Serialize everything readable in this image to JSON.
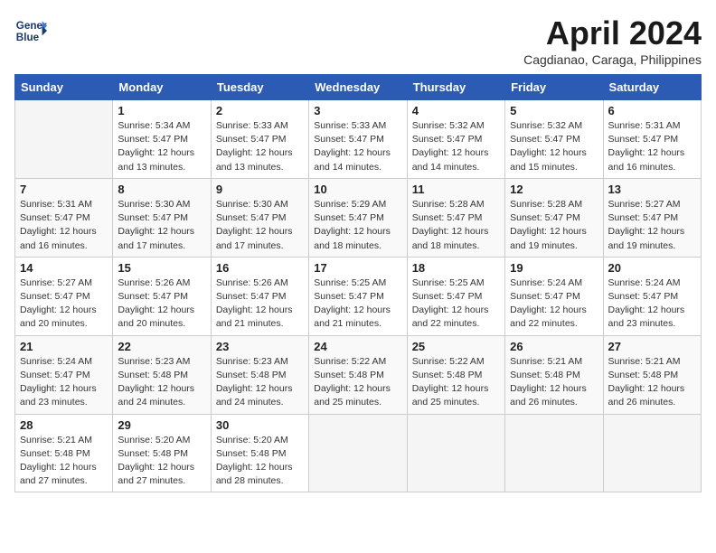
{
  "header": {
    "logo_line1": "General",
    "logo_line2": "Blue",
    "month_title": "April 2024",
    "subtitle": "Cagdianao, Caraga, Philippines"
  },
  "days_of_week": [
    "Sunday",
    "Monday",
    "Tuesday",
    "Wednesday",
    "Thursday",
    "Friday",
    "Saturday"
  ],
  "weeks": [
    [
      {
        "day": "",
        "info": ""
      },
      {
        "day": "1",
        "info": "Sunrise: 5:34 AM\nSunset: 5:47 PM\nDaylight: 12 hours\nand 13 minutes."
      },
      {
        "day": "2",
        "info": "Sunrise: 5:33 AM\nSunset: 5:47 PM\nDaylight: 12 hours\nand 13 minutes."
      },
      {
        "day": "3",
        "info": "Sunrise: 5:33 AM\nSunset: 5:47 PM\nDaylight: 12 hours\nand 14 minutes."
      },
      {
        "day": "4",
        "info": "Sunrise: 5:32 AM\nSunset: 5:47 PM\nDaylight: 12 hours\nand 14 minutes."
      },
      {
        "day": "5",
        "info": "Sunrise: 5:32 AM\nSunset: 5:47 PM\nDaylight: 12 hours\nand 15 minutes."
      },
      {
        "day": "6",
        "info": "Sunrise: 5:31 AM\nSunset: 5:47 PM\nDaylight: 12 hours\nand 16 minutes."
      }
    ],
    [
      {
        "day": "7",
        "info": "Sunrise: 5:31 AM\nSunset: 5:47 PM\nDaylight: 12 hours\nand 16 minutes."
      },
      {
        "day": "8",
        "info": "Sunrise: 5:30 AM\nSunset: 5:47 PM\nDaylight: 12 hours\nand 17 minutes."
      },
      {
        "day": "9",
        "info": "Sunrise: 5:30 AM\nSunset: 5:47 PM\nDaylight: 12 hours\nand 17 minutes."
      },
      {
        "day": "10",
        "info": "Sunrise: 5:29 AM\nSunset: 5:47 PM\nDaylight: 12 hours\nand 18 minutes."
      },
      {
        "day": "11",
        "info": "Sunrise: 5:28 AM\nSunset: 5:47 PM\nDaylight: 12 hours\nand 18 minutes."
      },
      {
        "day": "12",
        "info": "Sunrise: 5:28 AM\nSunset: 5:47 PM\nDaylight: 12 hours\nand 19 minutes."
      },
      {
        "day": "13",
        "info": "Sunrise: 5:27 AM\nSunset: 5:47 PM\nDaylight: 12 hours\nand 19 minutes."
      }
    ],
    [
      {
        "day": "14",
        "info": "Sunrise: 5:27 AM\nSunset: 5:47 PM\nDaylight: 12 hours\nand 20 minutes."
      },
      {
        "day": "15",
        "info": "Sunrise: 5:26 AM\nSunset: 5:47 PM\nDaylight: 12 hours\nand 20 minutes."
      },
      {
        "day": "16",
        "info": "Sunrise: 5:26 AM\nSunset: 5:47 PM\nDaylight: 12 hours\nand 21 minutes."
      },
      {
        "day": "17",
        "info": "Sunrise: 5:25 AM\nSunset: 5:47 PM\nDaylight: 12 hours\nand 21 minutes."
      },
      {
        "day": "18",
        "info": "Sunrise: 5:25 AM\nSunset: 5:47 PM\nDaylight: 12 hours\nand 22 minutes."
      },
      {
        "day": "19",
        "info": "Sunrise: 5:24 AM\nSunset: 5:47 PM\nDaylight: 12 hours\nand 22 minutes."
      },
      {
        "day": "20",
        "info": "Sunrise: 5:24 AM\nSunset: 5:47 PM\nDaylight: 12 hours\nand 23 minutes."
      }
    ],
    [
      {
        "day": "21",
        "info": "Sunrise: 5:24 AM\nSunset: 5:47 PM\nDaylight: 12 hours\nand 23 minutes."
      },
      {
        "day": "22",
        "info": "Sunrise: 5:23 AM\nSunset: 5:48 PM\nDaylight: 12 hours\nand 24 minutes."
      },
      {
        "day": "23",
        "info": "Sunrise: 5:23 AM\nSunset: 5:48 PM\nDaylight: 12 hours\nand 24 minutes."
      },
      {
        "day": "24",
        "info": "Sunrise: 5:22 AM\nSunset: 5:48 PM\nDaylight: 12 hours\nand 25 minutes."
      },
      {
        "day": "25",
        "info": "Sunrise: 5:22 AM\nSunset: 5:48 PM\nDaylight: 12 hours\nand 25 minutes."
      },
      {
        "day": "26",
        "info": "Sunrise: 5:21 AM\nSunset: 5:48 PM\nDaylight: 12 hours\nand 26 minutes."
      },
      {
        "day": "27",
        "info": "Sunrise: 5:21 AM\nSunset: 5:48 PM\nDaylight: 12 hours\nand 26 minutes."
      }
    ],
    [
      {
        "day": "28",
        "info": "Sunrise: 5:21 AM\nSunset: 5:48 PM\nDaylight: 12 hours\nand 27 minutes."
      },
      {
        "day": "29",
        "info": "Sunrise: 5:20 AM\nSunset: 5:48 PM\nDaylight: 12 hours\nand 27 minutes."
      },
      {
        "day": "30",
        "info": "Sunrise: 5:20 AM\nSunset: 5:48 PM\nDaylight: 12 hours\nand 28 minutes."
      },
      {
        "day": "",
        "info": ""
      },
      {
        "day": "",
        "info": ""
      },
      {
        "day": "",
        "info": ""
      },
      {
        "day": "",
        "info": ""
      }
    ]
  ]
}
